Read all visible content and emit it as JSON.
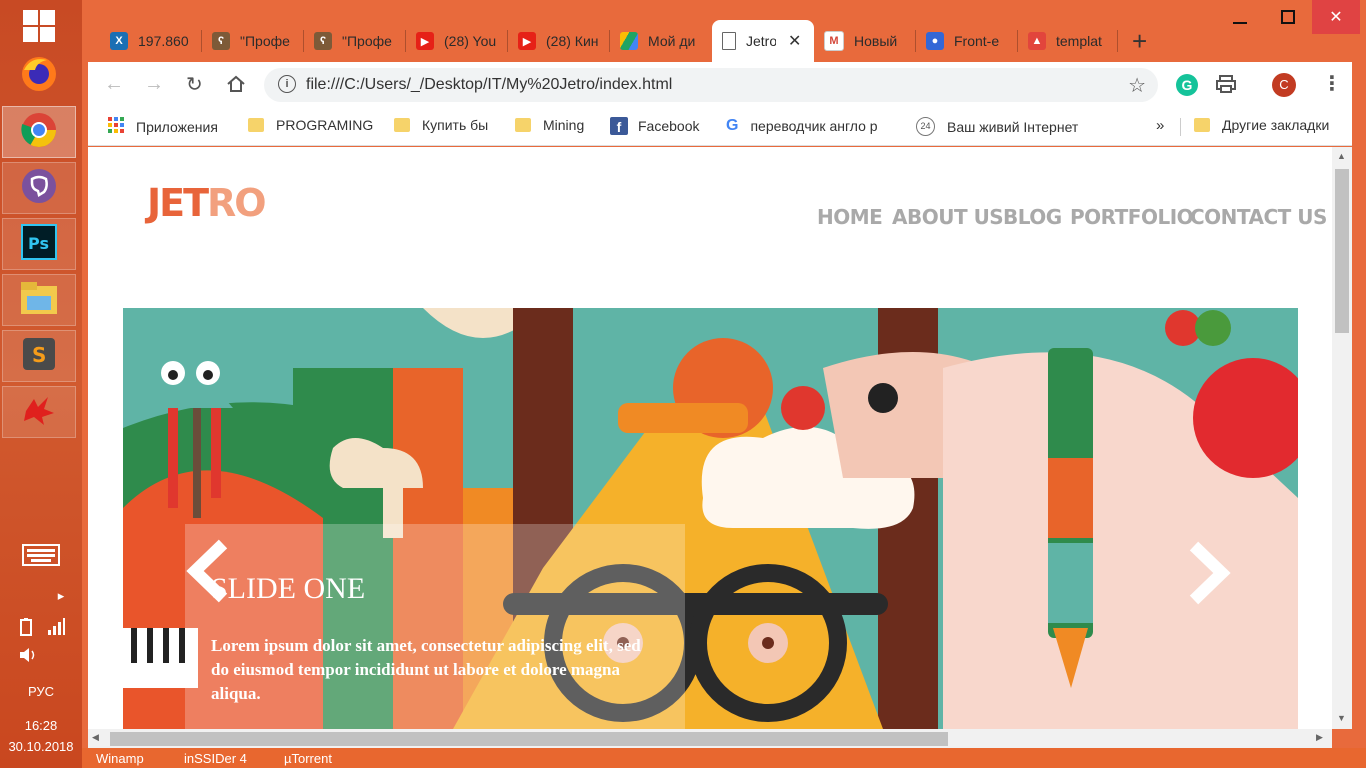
{
  "taskbar": {
    "apps": [
      "windows-start",
      "firefox",
      "chrome",
      "viber",
      "photoshop",
      "file-explorer",
      "sublime-text",
      "red-app"
    ],
    "language": "РУС",
    "time": "16:28",
    "date": "30.10.2018",
    "bottom_items": [
      "Winamp",
      "inSSIDer 4",
      "µTorrent"
    ]
  },
  "tabs": [
    {
      "title": "197.860",
      "icon": "x-icon",
      "color": "#1b6fb4"
    },
    {
      "title": "\"Профе",
      "icon": "bear-icon",
      "color": "#7d5a38"
    },
    {
      "title": "\"Профе",
      "icon": "bear-icon",
      "color": "#7d5a38"
    },
    {
      "title": "(28) You",
      "icon": "youtube-icon",
      "color": "#e62117"
    },
    {
      "title": "(28) Кин",
      "icon": "youtube-icon",
      "color": "#e62117"
    },
    {
      "title": "Мой ди",
      "icon": "drive-icon",
      "color": "#1fa463"
    },
    {
      "title": "Jetro",
      "icon": "page-icon",
      "color": "#666666"
    },
    {
      "title": "Новый",
      "icon": "gmail-icon",
      "color": "#d44638"
    },
    {
      "title": "Front-e",
      "icon": "contact-icon",
      "color": "#3367d6"
    },
    {
      "title": "templat",
      "icon": "image-icon",
      "color": "#e2453c"
    }
  ],
  "address": {
    "url": "file:///C:/Users/_/Desktop/IT/My%20Jetro/index.html"
  },
  "profile_initial": "С",
  "bookmarks": [
    {
      "label": "Приложения",
      "icon": "apps-grid-icon"
    },
    {
      "label": "PROGRAMING",
      "icon": "folder-icon"
    },
    {
      "label": "Купить бы",
      "icon": "folder-icon"
    },
    {
      "label": "Mining",
      "icon": "folder-icon"
    },
    {
      "label": "Facebook",
      "icon": "facebook-icon"
    },
    {
      "label": "переводчик англо р",
      "icon": "google-icon"
    },
    {
      "label": "Ваш живий Інтернет",
      "icon": "24-icon"
    },
    {
      "label": "»",
      "icon": ""
    },
    {
      "label": "Другие закладки",
      "icon": "folder-icon"
    }
  ],
  "site": {
    "logo_part1": "JET",
    "logo_part2": "RO",
    "nav": [
      "HOME",
      "ABOUT US",
      "BLOG",
      "PORTFOLIO",
      "CONTACT US"
    ],
    "slide": {
      "title": "SLIDE ONE",
      "text": "Lorem ipsum dolor sit amet, consectetur adipiscing elit, sed do eiusmod tempor incididunt ut labore et dolore magna aliqua."
    }
  },
  "colors": {
    "accent": "#e8672f",
    "logo_dark": "#e8643a",
    "logo_light": "#f2a07e",
    "nav": "#a9a9a9"
  }
}
